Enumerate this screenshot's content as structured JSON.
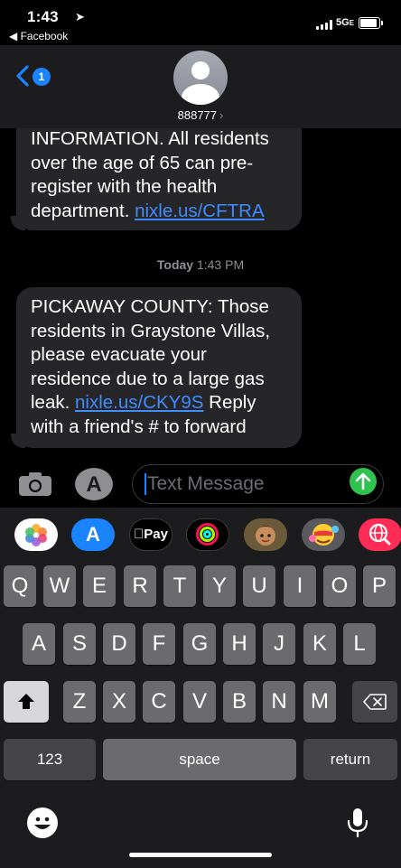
{
  "status_bar": {
    "time": "1:43",
    "location_arrow": "➤",
    "back_app": "◀ Facebook",
    "network": "5G",
    "network_suffix": "E"
  },
  "header": {
    "back_count": "1",
    "contact": "888777",
    "chevron": "›"
  },
  "messages": [
    {
      "parts": [
        "INFORMATION. All residents over the age of 65 can pre-register with the health department. "
      ],
      "link": "nixle.us/CFTRA",
      "after": ""
    },
    {
      "parts": [
        "PICKAWAY COUNTY: Those residents in Graystone Villas, please evacuate your residence due to a large gas leak. "
      ],
      "link": "nixle.us/CKY9S",
      "after": " Reply with a friend's # to forward"
    }
  ],
  "timestamp": {
    "day": "Today",
    "time": " 1:43 PM"
  },
  "compose": {
    "placeholder": "Text Message"
  },
  "app_strip": {
    "apps": [
      "photos-app",
      "app-store-app",
      "apple-pay-app",
      "fitness-app",
      "memoji-app",
      "memoji-stickers-app",
      "web-search-app"
    ],
    "pay_label": "Pay"
  },
  "keyboard": {
    "row1": [
      "Q",
      "W",
      "E",
      "R",
      "T",
      "Y",
      "U",
      "I",
      "O",
      "P"
    ],
    "row2": [
      "A",
      "S",
      "D",
      "F",
      "G",
      "H",
      "J",
      "K",
      "L"
    ],
    "row3": [
      "Z",
      "X",
      "C",
      "V",
      "B",
      "N",
      "M"
    ],
    "numbers": "123",
    "space": "space",
    "return": "return"
  },
  "colors": {
    "accent": "#1a84ff",
    "bubble": "#262629",
    "link": "#3f8cff",
    "send": "#2ec24f"
  }
}
